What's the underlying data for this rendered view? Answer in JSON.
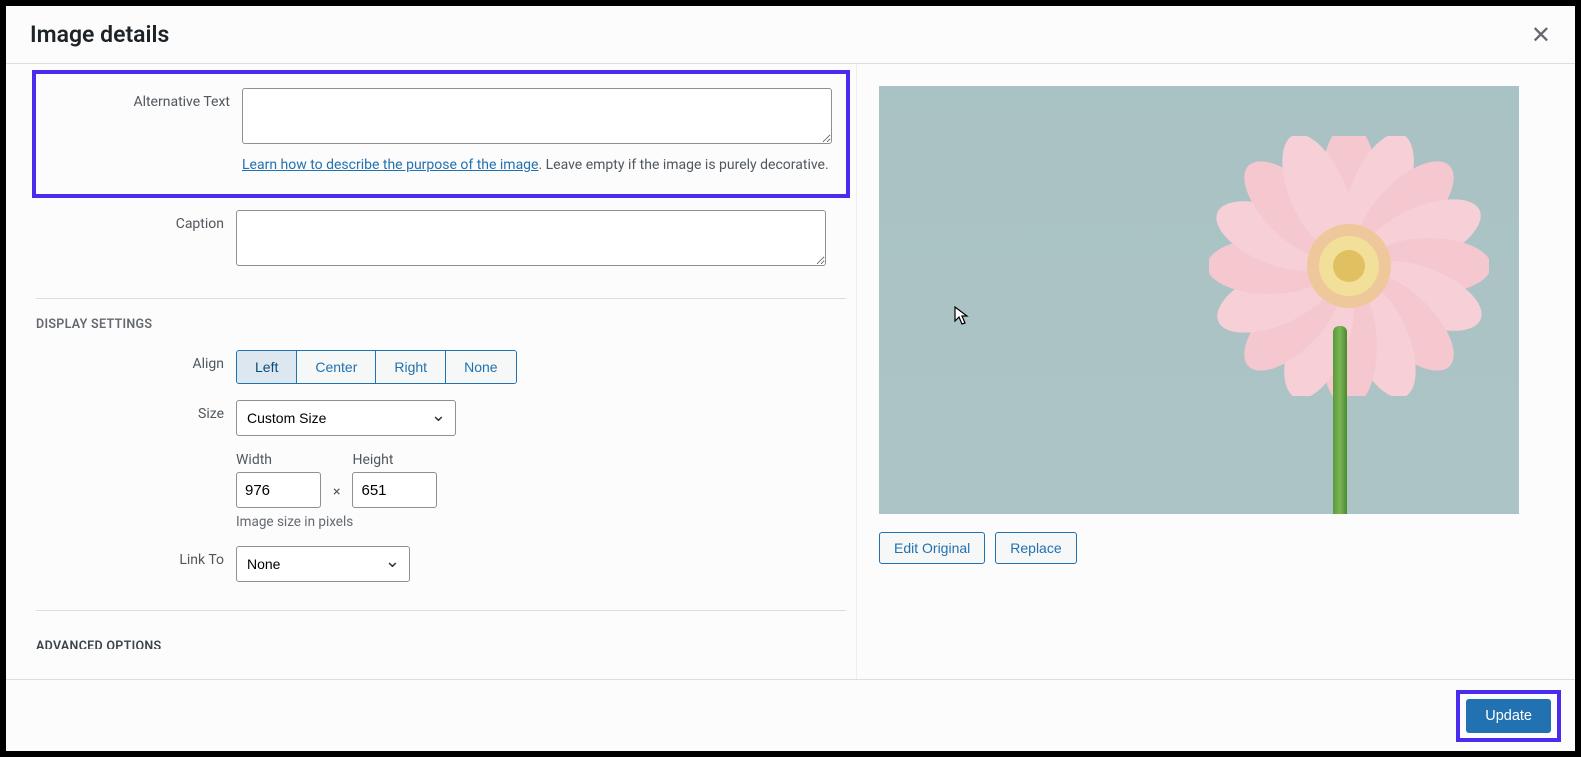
{
  "modal": {
    "title": "Image details",
    "close_label": "Close"
  },
  "fields": {
    "alt": {
      "label": "Alternative Text",
      "value": "",
      "help_link_text": "Learn how to describe the purpose of the image",
      "help_suffix": ". Leave empty if the image is purely decorative."
    },
    "caption": {
      "label": "Caption",
      "value": ""
    }
  },
  "display": {
    "section_title": "DISPLAY SETTINGS",
    "align": {
      "label": "Align",
      "options": [
        "Left",
        "Center",
        "Right",
        "None"
      ],
      "selected": "Left"
    },
    "size": {
      "label": "Size",
      "selected": "Custom Size"
    },
    "dimensions": {
      "width_label": "Width",
      "height_label": "Height",
      "width": "976",
      "height": "651",
      "help": "Image size in pixels"
    },
    "link_to": {
      "label": "Link To",
      "selected": "None"
    }
  },
  "advanced": {
    "title": "ADVANCED OPTIONS"
  },
  "preview": {
    "edit_original": "Edit Original",
    "replace": "Replace"
  },
  "footer": {
    "update": "Update"
  }
}
